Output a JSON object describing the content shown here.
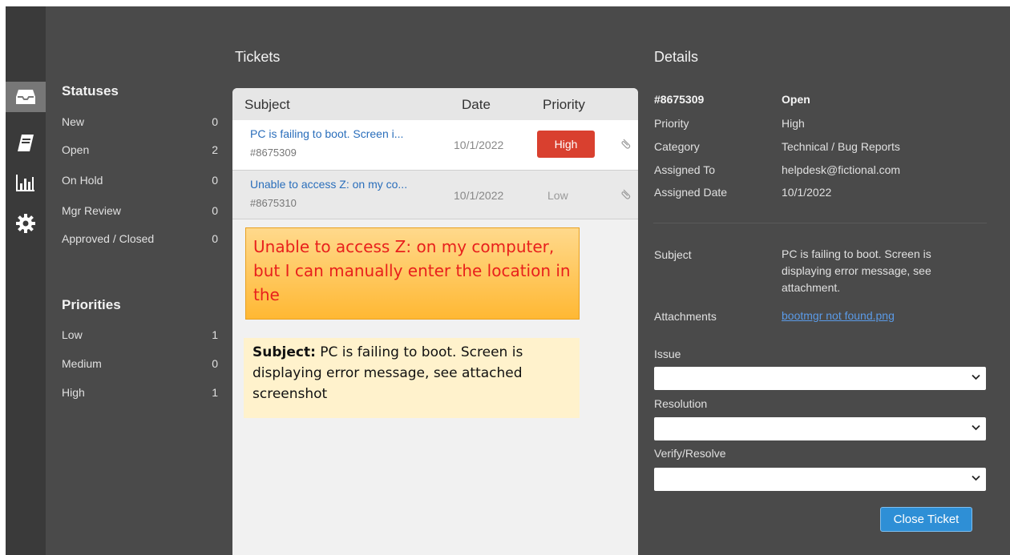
{
  "filters": {
    "statuses_title": "Statuses",
    "statuses": [
      {
        "label": "New",
        "count": "0"
      },
      {
        "label": "Open",
        "count": "2"
      },
      {
        "label": "On Hold",
        "count": "0"
      },
      {
        "label": "Mgr Review",
        "count": "0"
      },
      {
        "label": "Approved / Closed",
        "count": "0"
      }
    ],
    "priorities_title": "Priorities",
    "priorities": [
      {
        "label": "Low",
        "count": "1"
      },
      {
        "label": "Medium",
        "count": "0"
      },
      {
        "label": "High",
        "count": "1"
      }
    ]
  },
  "tickets": {
    "title": "Tickets",
    "headers": {
      "subject": "Subject",
      "date": "Date",
      "priority": "Priority"
    },
    "rows": [
      {
        "subject": "PC is failing to boot. Screen i...",
        "id": "#8675309",
        "date": "10/1/2022",
        "priority": "High"
      },
      {
        "subject": "Unable to access Z: on my co...",
        "id": "#8675310",
        "date": "10/1/2022",
        "priority": "Low"
      }
    ]
  },
  "callouts": {
    "first": "Unable to access Z: on my computer, but I can manually enter the location in the",
    "second_label": "Subject:",
    "second_text": " PC is failing to boot. Screen is displaying error message, see attached screenshot"
  },
  "details": {
    "title": "Details",
    "ticket_id": "#8675309",
    "status": "Open",
    "fields": [
      {
        "key": "Priority",
        "value": "High"
      },
      {
        "key": "Category",
        "value": "Technical / Bug Reports"
      },
      {
        "key": "Assigned To",
        "value": "helpdesk@fictional.com"
      },
      {
        "key": "Assigned Date",
        "value": "10/1/2022"
      }
    ],
    "subject_label": "Subject",
    "subject_text": "PC is failing to boot. Screen is displaying error message, see attachment.",
    "attachments_label": "Attachments",
    "attachment_name": "bootmgr not found.png",
    "issue_label": "Issue",
    "resolution_label": "Resolution",
    "verify_label": "Verify/Resolve",
    "close_button": "Close Ticket"
  },
  "colors": {
    "high_priority": "#d9402f",
    "button_accent": "#2e8fd6",
    "link": "#2a6ebb"
  }
}
